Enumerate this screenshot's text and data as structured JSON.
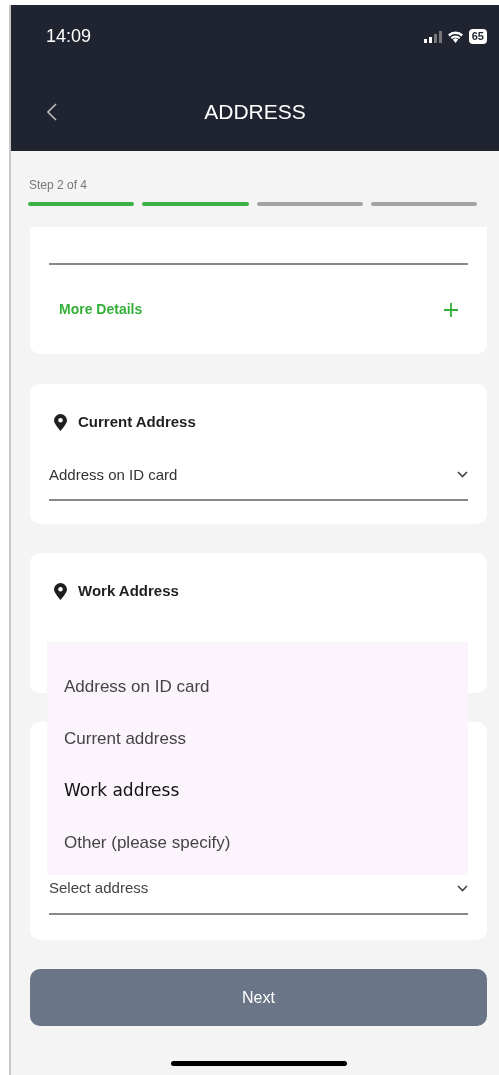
{
  "status_bar": {
    "time": "14:09",
    "battery": "65"
  },
  "header": {
    "title": "ADDRESS"
  },
  "progress": {
    "label": "Step 2 of 4",
    "steps": [
      {
        "done": true
      },
      {
        "done": true
      },
      {
        "done": false
      },
      {
        "done": false
      }
    ]
  },
  "details_card": {
    "link": "More Details"
  },
  "address_cards": [
    {
      "title": "Current Address",
      "value": "Address on ID card"
    },
    {
      "title": "Work Address"
    },
    {
      "placeholder": "Select address"
    }
  ],
  "dropdown": {
    "options": [
      {
        "label": "Address on ID card",
        "selected": false
      },
      {
        "label": "Current address",
        "selected": false
      },
      {
        "label": "Work address",
        "selected": true
      },
      {
        "label": "Other (please specify)",
        "selected": false
      }
    ]
  },
  "next_button": {
    "label": "Next"
  }
}
